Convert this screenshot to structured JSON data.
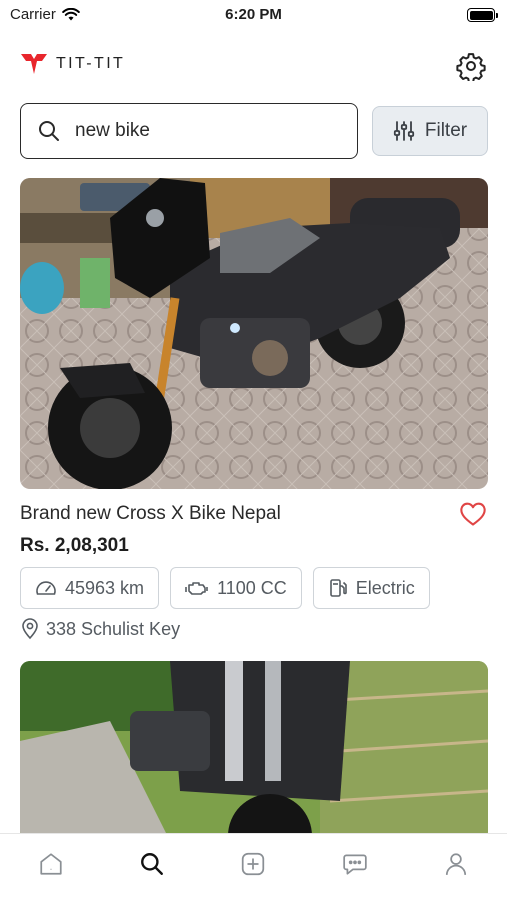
{
  "status_bar": {
    "carrier": "Carrier",
    "time": "6:20 PM"
  },
  "header": {
    "logo_text": "TIT-TIT",
    "logo_color": "#e8262c"
  },
  "search": {
    "value": "new bike",
    "filter_label": "Filter"
  },
  "listings": [
    {
      "title": "Brand new Cross X Bike Nepal",
      "price": "Rs. 2,08,301",
      "mileage": "45963 km",
      "engine": "1100 CC",
      "fuel": "Electric",
      "location": "338 Schulist Key",
      "favorited": false
    },
    {}
  ],
  "bottom_nav": {
    "items": [
      "home-icon",
      "search-icon",
      "add-icon",
      "chat-icon",
      "profile-icon"
    ],
    "active": "search-icon"
  },
  "colors": {
    "accent": "#e8262c",
    "heart": "#e04545",
    "filter_bg": "#e9edf1"
  }
}
